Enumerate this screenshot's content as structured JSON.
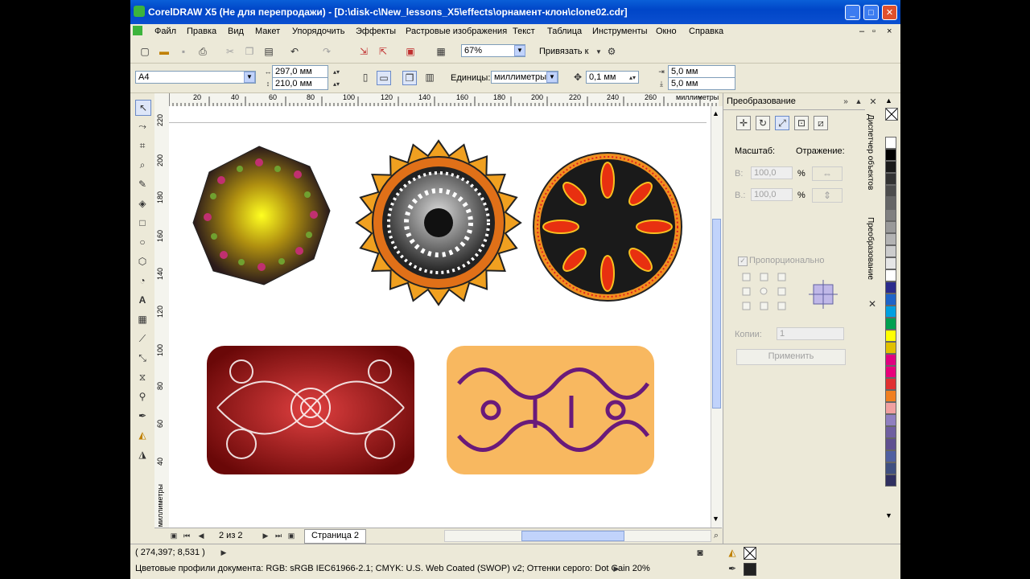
{
  "window": {
    "title": "CorelDRAW X5 (Не для перепродажи) - [D:\\disk-c\\New_lessons_X5\\effects\\орнамент-клон\\clone02.cdr]",
    "min": "_",
    "max": "□",
    "close": "✕"
  },
  "menu": [
    "Файл",
    "Правка",
    "Вид",
    "Макет",
    "Упорядочить",
    "Эффекты",
    "Растровые изображения",
    "Текст",
    "Таблица",
    "Инструменты",
    "Окно",
    "Справка"
  ],
  "mdi": {
    "min": "–",
    "restore": "▫",
    "close": "×"
  },
  "toolbar": {
    "zoom": "67%",
    "snap_label": "Привязать к"
  },
  "propbar": {
    "page_size": "A4",
    "width": "297,0 мм",
    "height": "210,0 мм",
    "units_label": "Единицы:",
    "units": "миллиметры",
    "nudge": "0,1 мм",
    "dup_x": "5,0 мм",
    "dup_y": "5,0 мм"
  },
  "ruler": {
    "h_ticks": [
      "20",
      "40",
      "60",
      "80",
      "100",
      "120",
      "140",
      "160",
      "180",
      "200",
      "220",
      "240",
      "260"
    ],
    "h_unit": "миллиметры",
    "v_ticks": [
      "220",
      "200",
      "180",
      "160",
      "140",
      "120",
      "100",
      "80",
      "60",
      "40"
    ],
    "v_unit": "миллиметры"
  },
  "pagenav": {
    "count": "2 из 2",
    "tab": "Страница 2"
  },
  "status": {
    "coords": "( 274,397; 8,531 )",
    "profiles": "Цветовые профили документа: RGB: sRGB IEC61966-2.1; CMYK: U.S. Web Coated (SWOP) v2; Оттенки серого: Dot Gain 20%"
  },
  "docker": {
    "title": "Преобразование",
    "scale_label": "Масштаб:",
    "mirror_label": "Отражение:",
    "w_label": "В:",
    "w_value": "100,0",
    "h_label": "В.:",
    "h_value": "100,0",
    "pct": "%",
    "proportional": "Пропорционально",
    "copies_label": "Копии:",
    "copies": "1",
    "apply": "Применить",
    "tab1": "Диспетчер объектов",
    "tab2": "Преобразование"
  },
  "palette": [
    "#ffffff",
    "#000000",
    "#1a1a1a",
    "#333333",
    "#4d4d4d",
    "#666666",
    "#808080",
    "#999999",
    "#b3b3b3",
    "#cccccc",
    "#e6e6e6",
    "#ffffff",
    "#2a2a8c",
    "#1e64c8",
    "#00a0e0",
    "#00a050",
    "#ffff00",
    "#e0c000",
    "#e00080",
    "#e8007a",
    "#e03030",
    "#f08020",
    "#f0a0a0",
    "#9080c0",
    "#7060a0",
    "#605090",
    "#5060a0",
    "#405080",
    "#303060"
  ]
}
